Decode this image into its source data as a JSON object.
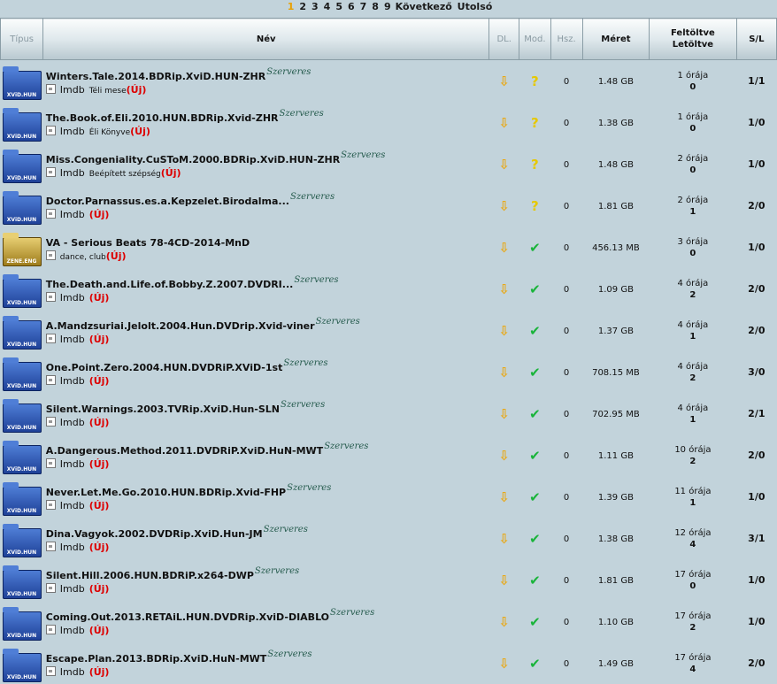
{
  "pager": {
    "pages": [
      "1",
      "2",
      "3",
      "4",
      "5",
      "6",
      "7",
      "8",
      "9"
    ],
    "current": "1",
    "next_label": "Következő",
    "last_label": "Utolsó"
  },
  "headers": {
    "type": "Típus",
    "name": "Név",
    "dl": "DL.",
    "mod": "Mod.",
    "hsz": "Hsz.",
    "size": "Méret",
    "up1": "Feltöltve",
    "up2": "Letöltve",
    "sl": "S/L"
  },
  "szerveres": "Szerveres",
  "imdb": "Imdb",
  "uj": "(Új)",
  "rows": [
    {
      "icon": "xvid",
      "name": "Winters.Tale.2014.BDRip.XviD.HUN-ZHR",
      "szerveres": true,
      "imdb": true,
      "sub": "Téli mese",
      "mod": "?",
      "hsz": "0",
      "size": "1.48 GB",
      "uploaded": "1 órája",
      "downloaded": "0",
      "sl": "1/1"
    },
    {
      "icon": "xvid",
      "name": "The.Book.of.Eli.2010.HUN.BDRip.Xvid-ZHR",
      "szerveres": true,
      "imdb": true,
      "sub": "Éli Könyve",
      "mod": "?",
      "hsz": "0",
      "size": "1.38 GB",
      "uploaded": "1 órája",
      "downloaded": "0",
      "sl": "1/0"
    },
    {
      "icon": "xvid",
      "name": "Miss.Congeniality.CuSToM.2000.BDRip.XviD.HUN-ZHR",
      "szerveres": true,
      "imdb": true,
      "sub": "Beépített szépség",
      "mod": "?",
      "hsz": "0",
      "size": "1.48 GB",
      "uploaded": "2 órája",
      "downloaded": "0",
      "sl": "1/0"
    },
    {
      "icon": "xvid",
      "name": "Doctor.Parnassus.es.a.Kepzelet.Birodalma...",
      "szerveres": true,
      "imdb": true,
      "sub": "",
      "mod": "?",
      "hsz": "0",
      "size": "1.81 GB",
      "uploaded": "2 órája",
      "downloaded": "1",
      "sl": "2/0"
    },
    {
      "icon": "zene",
      "name": "VA - Serious Beats 78-4CD-2014-MnD",
      "szerveres": false,
      "imdb": false,
      "sub": "dance, club",
      "mod": "ok",
      "hsz": "0",
      "size": "456.13 MB",
      "uploaded": "3 órája",
      "downloaded": "0",
      "sl": "1/0"
    },
    {
      "icon": "xvid",
      "name": "The.Death.and.Life.of.Bobby.Z.2007.DVDRI...",
      "szerveres": true,
      "imdb": true,
      "sub": "",
      "mod": "ok",
      "hsz": "0",
      "size": "1.09 GB",
      "uploaded": "4 órája",
      "downloaded": "2",
      "sl": "2/0"
    },
    {
      "icon": "xvid",
      "name": "A.Mandzsuriai.Jelolt.2004.Hun.DVDrip.Xvid-viner",
      "szerveres": true,
      "imdb": true,
      "sub": "",
      "mod": "ok",
      "hsz": "0",
      "size": "1.37 GB",
      "uploaded": "4 órája",
      "downloaded": "1",
      "sl": "2/0"
    },
    {
      "icon": "xvid",
      "name": "One.Point.Zero.2004.HUN.DVDRiP.XViD-1st",
      "szerveres": true,
      "imdb": true,
      "sub": "",
      "mod": "ok",
      "hsz": "0",
      "size": "708.15 MB",
      "uploaded": "4 órája",
      "downloaded": "2",
      "sl": "3/0"
    },
    {
      "icon": "xvid",
      "name": "Silent.Warnings.2003.TVRip.XviD.Hun-SLN",
      "szerveres": true,
      "imdb": true,
      "sub": "",
      "mod": "ok",
      "hsz": "0",
      "size": "702.95 MB",
      "uploaded": "4 órája",
      "downloaded": "1",
      "sl": "2/1"
    },
    {
      "icon": "xvid",
      "name": "A.Dangerous.Method.2011.DVDRiP.XviD.HuN-MWT",
      "szerveres": true,
      "imdb": true,
      "sub": "",
      "mod": "ok",
      "hsz": "0",
      "size": "1.11 GB",
      "uploaded": "10 órája",
      "downloaded": "2",
      "sl": "2/0"
    },
    {
      "icon": "xvid",
      "name": "Never.Let.Me.Go.2010.HUN.BDRip.Xvid-FHP",
      "szerveres": true,
      "imdb": true,
      "sub": "",
      "mod": "ok",
      "hsz": "0",
      "size": "1.39 GB",
      "uploaded": "11 órája",
      "downloaded": "1",
      "sl": "1/0"
    },
    {
      "icon": "xvid",
      "name": "Dina.Vagyok.2002.DVDRip.XviD.Hun-JM",
      "szerveres": true,
      "imdb": true,
      "sub": "",
      "mod": "ok",
      "hsz": "0",
      "size": "1.38 GB",
      "uploaded": "12 órája",
      "downloaded": "4",
      "sl": "3/1"
    },
    {
      "icon": "xvid",
      "name": "Silent.Hill.2006.HUN.BDRiP.x264-DWP",
      "szerveres": true,
      "imdb": true,
      "sub": "",
      "mod": "ok",
      "hsz": "0",
      "size": "1.81 GB",
      "uploaded": "17 órája",
      "downloaded": "0",
      "sl": "1/0"
    },
    {
      "icon": "xvid",
      "name": "Coming.Out.2013.RETAiL.HUN.DVDRip.XviD-DIABLO",
      "szerveres": true,
      "imdb": true,
      "sub": "",
      "mod": "ok",
      "hsz": "0",
      "size": "1.10 GB",
      "uploaded": "17 órája",
      "downloaded": "2",
      "sl": "1/0"
    },
    {
      "icon": "xvid",
      "name": "Escape.Plan.2013.BDRip.XviD.HuN-MWT",
      "szerveres": true,
      "imdb": true,
      "sub": "",
      "mod": "ok",
      "hsz": "0",
      "size": "1.49 GB",
      "uploaded": "17 órája",
      "downloaded": "4",
      "sl": "2/0"
    }
  ],
  "icon_labels": {
    "xvid": "XViD.HUN",
    "zene": "ZENE.ENG"
  },
  "colors": {
    "background": "#c2d3db",
    "new_badge": "#dd0000",
    "szerveres": "#245a4c",
    "pager_current": "#e8a000"
  }
}
